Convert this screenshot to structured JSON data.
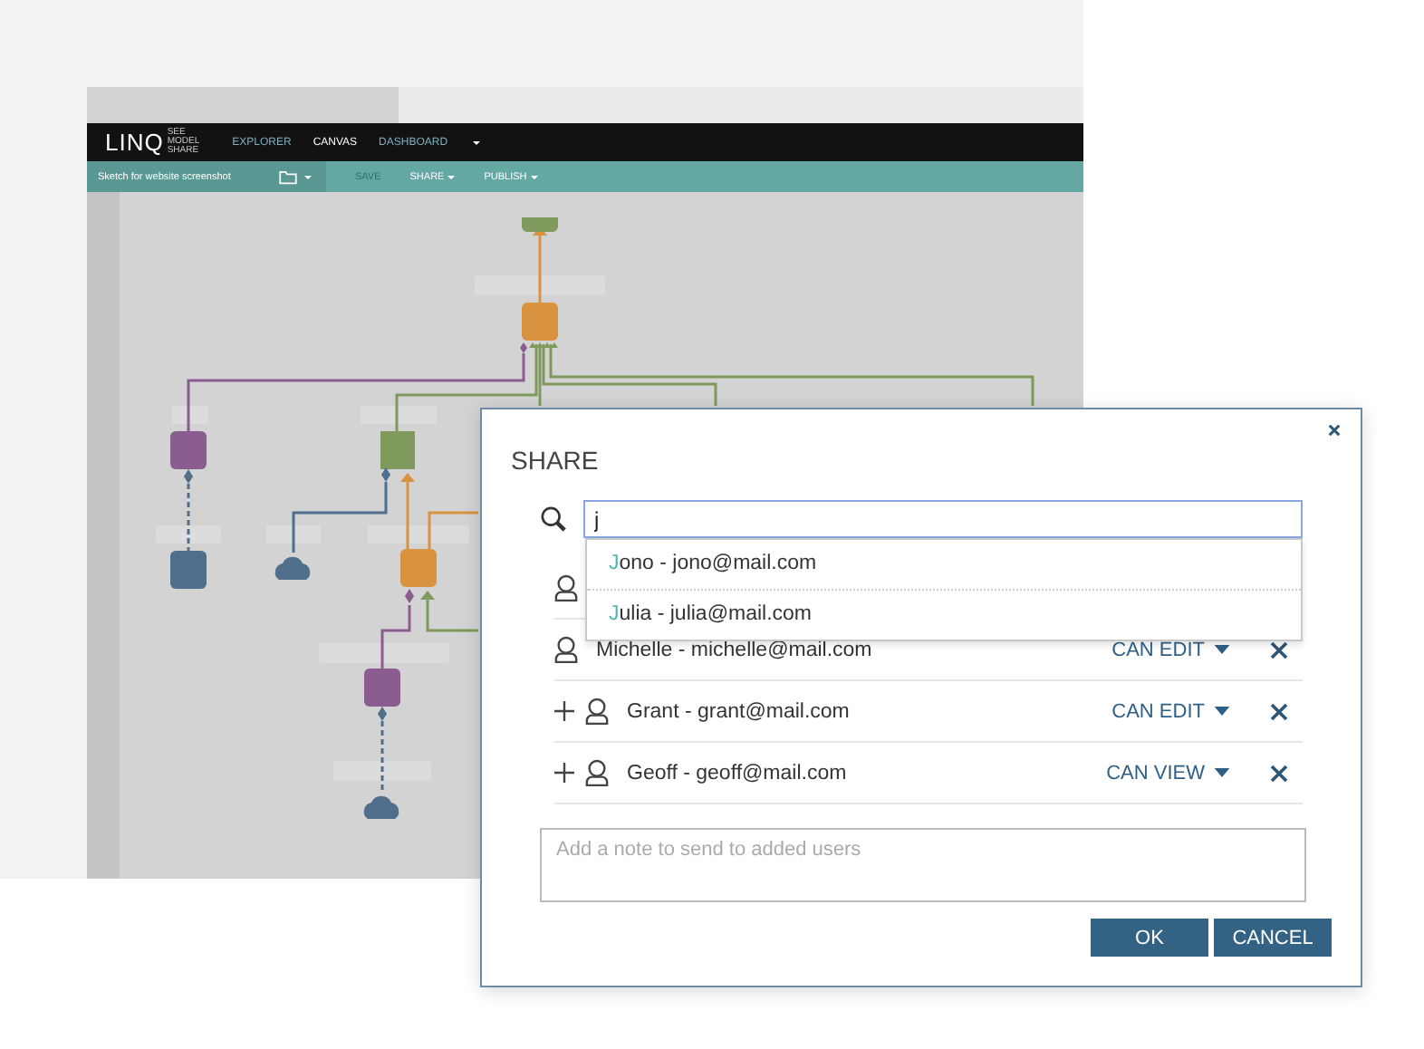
{
  "app": {
    "logo": "LINQ",
    "logo_tagline": [
      "SEE",
      "MODEL",
      "SHARE"
    ],
    "nav": [
      {
        "label": "EXPLORER",
        "selected": false,
        "has_menu": false
      },
      {
        "label": "CANVAS",
        "selected": true,
        "has_menu": false
      },
      {
        "label": "DASHBOARD",
        "selected": false,
        "has_menu": true
      }
    ],
    "document_title": "Sketch for website screenshot",
    "toolbar": [
      {
        "label": "SAVE",
        "disabled": true,
        "has_menu": false
      },
      {
        "label": "SHARE",
        "disabled": false,
        "has_menu": true
      },
      {
        "label": "PUBLISH",
        "disabled": false,
        "has_menu": true
      }
    ]
  },
  "dialog": {
    "title": "SHARE",
    "search": {
      "value": "j"
    },
    "suggestions": [
      {
        "match": "J",
        "rest": "ono - jono@mail.com"
      },
      {
        "match": "J",
        "rest": "ulia - julia@mail.com"
      }
    ],
    "users": [
      {
        "pending": false
      },
      {
        "label": "Michelle - michelle@mail.com",
        "pending": false,
        "permission": "CAN EDIT"
      },
      {
        "label": "Grant - grant@mail.com",
        "pending": true,
        "permission": "CAN EDIT"
      },
      {
        "label": "Geoff - geoff@mail.com",
        "pending": true,
        "permission": "CAN VIEW"
      }
    ],
    "note": {
      "placeholder": "Add a note to send to added users"
    },
    "buttons": [
      "OK",
      "CANCEL"
    ]
  }
}
